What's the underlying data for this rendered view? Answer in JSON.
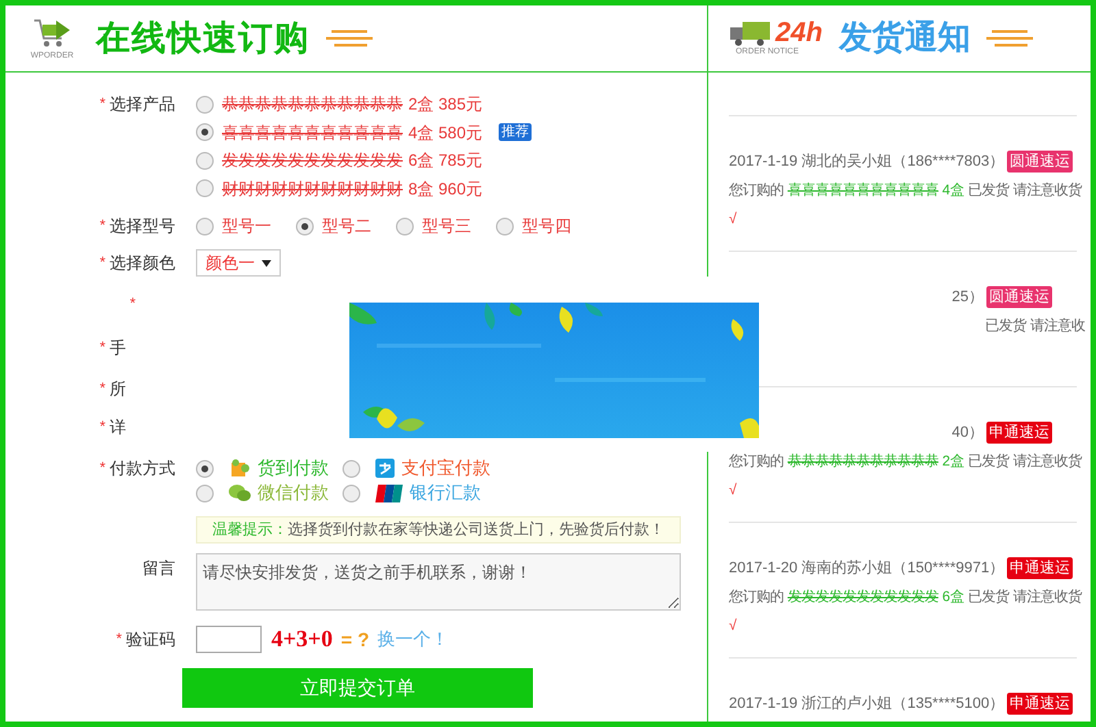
{
  "order_panel": {
    "title": "在线快速订购",
    "logo_caption": "WPORDER",
    "form": {
      "product": {
        "label": "选择产品",
        "required_mark": "*",
        "options": [
          {
            "name": "恭恭恭恭恭恭恭恭恭恭恭",
            "detail": "2盒 385元",
            "selected": false
          },
          {
            "name": "喜喜喜喜喜喜喜喜喜喜喜",
            "detail": "4盒 580元",
            "selected": true,
            "tag": "推荐"
          },
          {
            "name": "发发发发发发发发发发发",
            "detail": "6盒 785元",
            "selected": false
          },
          {
            "name": "财财财财财财财财财财财",
            "detail": "8盒 960元",
            "selected": false
          }
        ]
      },
      "model": {
        "label": "选择型号",
        "required_mark": "*",
        "options": [
          {
            "label": "型号一",
            "selected": false
          },
          {
            "label": "型号二",
            "selected": true
          },
          {
            "label": "型号三",
            "selected": false
          },
          {
            "label": "型号四",
            "selected": false
          }
        ]
      },
      "color": {
        "label": "选择颜色",
        "required_mark": "*",
        "value": "颜色一"
      },
      "hidden_rows": [
        {
          "required_mark": "*"
        },
        {
          "label": "手",
          "required_mark": "*"
        },
        {
          "label": "所",
          "required_mark": "*"
        },
        {
          "label": "详",
          "required_mark": "*"
        }
      ],
      "payment": {
        "label": "付款方式",
        "required_mark": "*",
        "options": [
          {
            "kind": "cod",
            "label": "货到付款",
            "color": "#2db82d",
            "selected": true
          },
          {
            "kind": "alipay",
            "label": "支付宝付款",
            "color": "#f0582c",
            "selected": false
          },
          {
            "kind": "wechat",
            "label": "微信付款",
            "color": "#8cb83a",
            "selected": false
          },
          {
            "kind": "bank",
            "label": "银行汇款",
            "color": "#3ba6e0",
            "selected": false
          }
        ]
      },
      "tip": {
        "label": "温馨提示：",
        "text": "选择货到付款在家等快递公司送货上门，先验货后付款！"
      },
      "message": {
        "label": "留言",
        "value": "请尽快安排发货，送货之前手机联系，谢谢！"
      },
      "captcha": {
        "label": "验证码",
        "required_mark": "*",
        "question": "4+3+0",
        "equals": "= ?",
        "refresh": "换一个！"
      },
      "submit": "立即提交订单"
    }
  },
  "notice_panel": {
    "badge": "24h",
    "logo_caption": "ORDER NOTICE",
    "title": "发货通知",
    "entries": [
      {
        "clipped": false,
        "date_line": "2017-1-19 湖北的吴小姐（186****7803）",
        "courier": "圆通速运",
        "color": "#e8336d",
        "prefix": "您订购的",
        "product": "喜喜喜喜喜喜喜喜喜喜喜",
        "quantity": "4盒",
        "status": "已发货 请注意收货",
        "check": "√"
      },
      {
        "clipped": true,
        "date_line": "25）",
        "courier": "圆通速运",
        "color": "#e8336d",
        "status": "已发货 请注意收"
      },
      {
        "clipped": true,
        "date_line": "40）",
        "courier": "申通速运",
        "color": "#e60012",
        "prefix": "您订购的",
        "product": "恭恭恭恭恭恭恭恭恭恭恭",
        "quantity": "2盒",
        "status": "已发货 请注意收货",
        "check": "√"
      },
      {
        "clipped": false,
        "date_line": "2017-1-20 海南的苏小姐（150****9971）",
        "courier": "申通速运",
        "color": "#e60012",
        "prefix": "您订购的",
        "product": "发发发发发发发发发发发",
        "quantity": "6盒",
        "status": "已发货 请注意收货",
        "check": "√"
      },
      {
        "clipped": false,
        "date_line": "2017-1-19 浙江的卢小姐（135****5100）",
        "courier": "申通速运",
        "color": "#e60012"
      }
    ]
  }
}
